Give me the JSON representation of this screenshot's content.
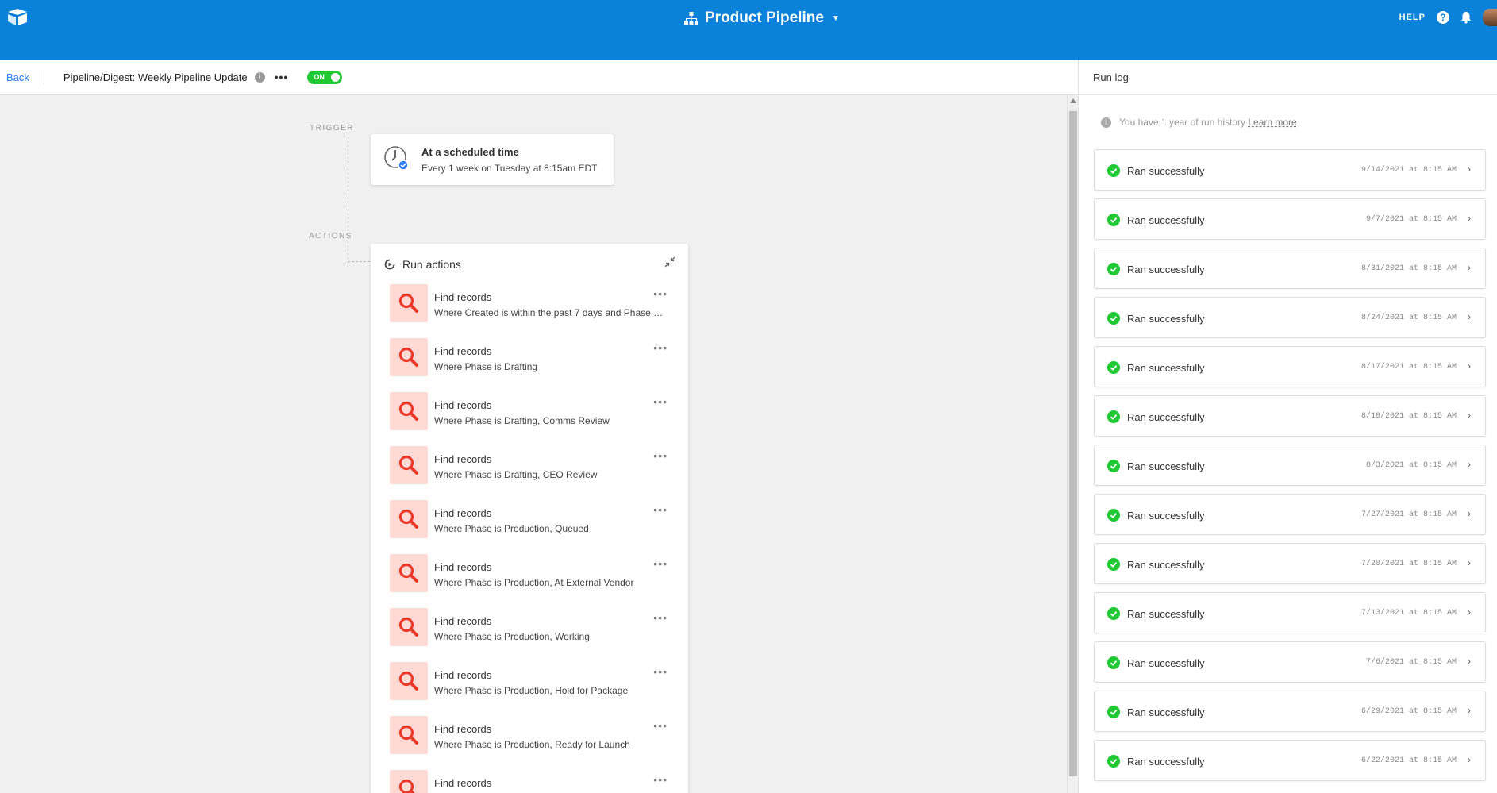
{
  "topbar": {
    "app_title": "Product Pipeline",
    "help_label": "HELP",
    "help_icon_glyph": "?"
  },
  "subheader": {
    "back_label": "Back",
    "automation_name": "Pipeline/Digest: Weekly Pipeline Update",
    "more_label": "•••",
    "toggle_label": "ON"
  },
  "canvas": {
    "trigger_section": "TRIGGER",
    "actions_section": "ACTIONS",
    "trigger": {
      "title": "At a scheduled time",
      "subtitle": "Every 1 week on Tuesday at 8:15am EDT"
    },
    "actions_title": "Run actions",
    "actions": [
      {
        "title": "Find records",
        "subtitle": "Where Created is within the past 7 days and Phase is…"
      },
      {
        "title": "Find records",
        "subtitle": "Where Phase is Drafting"
      },
      {
        "title": "Find records",
        "subtitle": "Where Phase is Drafting, Comms Review"
      },
      {
        "title": "Find records",
        "subtitle": "Where Phase is Drafting, CEO Review"
      },
      {
        "title": "Find records",
        "subtitle": "Where Phase is Production, Queued"
      },
      {
        "title": "Find records",
        "subtitle": "Where Phase is Production, At External Vendor"
      },
      {
        "title": "Find records",
        "subtitle": "Where Phase is Production, Working"
      },
      {
        "title": "Find records",
        "subtitle": "Where Phase is Production, Hold for Package"
      },
      {
        "title": "Find records",
        "subtitle": "Where Phase is Production, Ready for Launch"
      },
      {
        "title": "Find records",
        "subtitle": ""
      }
    ],
    "action_more_label": "•••"
  },
  "runlog": {
    "title": "Run log",
    "history_note": "You have 1 year of run history",
    "learn_more": "Learn more",
    "runs": [
      {
        "label": "Ran successfully",
        "time": "9/14/2021 at 8:15 AM"
      },
      {
        "label": "Ran successfully",
        "time": "9/7/2021 at 8:15 AM"
      },
      {
        "label": "Ran successfully",
        "time": "8/31/2021 at 8:15 AM"
      },
      {
        "label": "Ran successfully",
        "time": "8/24/2021 at 8:15 AM"
      },
      {
        "label": "Ran successfully",
        "time": "8/17/2021 at 8:15 AM"
      },
      {
        "label": "Ran successfully",
        "time": "8/10/2021 at 8:15 AM"
      },
      {
        "label": "Ran successfully",
        "time": "8/3/2021 at 8:15 AM"
      },
      {
        "label": "Ran successfully",
        "time": "7/27/2021 at 8:15 AM"
      },
      {
        "label": "Ran successfully",
        "time": "7/20/2021 at 8:15 AM"
      },
      {
        "label": "Ran successfully",
        "time": "7/13/2021 at 8:15 AM"
      },
      {
        "label": "Ran successfully",
        "time": "7/6/2021 at 8:15 AM"
      },
      {
        "label": "Ran successfully",
        "time": "6/29/2021 at 8:15 AM"
      },
      {
        "label": "Ran successfully",
        "time": "6/22/2021 at 8:15 AM"
      }
    ]
  },
  "colors": {
    "topbar": "#0a82da",
    "toggle_on": "#20c933",
    "link": "#2d7ff9",
    "action_icon_bg": "#ffdad5",
    "action_icon": "#e8392b",
    "success": "#20c933"
  },
  "icons": {
    "logo": "airtable-logo-icon",
    "base": "base-icon",
    "help": "help-icon",
    "notifications": "bell-icon",
    "trigger": "clock-icon",
    "run_actions": "run-actions-icon",
    "collapse": "collapse-icon",
    "find_records": "search-icon",
    "success": "check-circle-icon",
    "open_run": "chevron-right-icon"
  }
}
